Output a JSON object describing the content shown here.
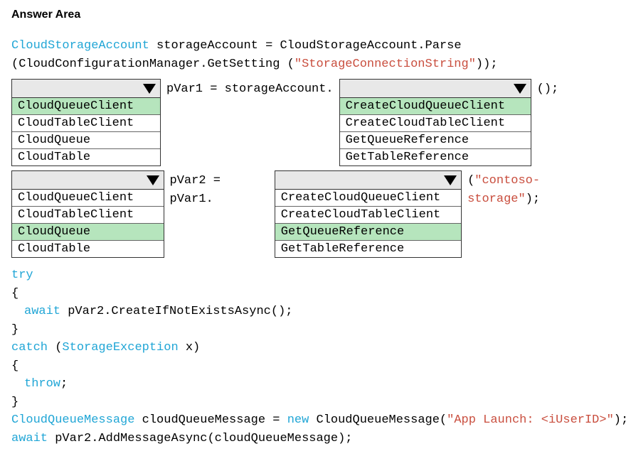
{
  "title": "Answer Area",
  "line1": {
    "type": "CloudStorageAccount",
    "assign": " storageAccount = CloudStorageAccount.Parse"
  },
  "line2": {
    "p1": "(CloudConfigurationManager.GetSetting (",
    "str": "\"StorageConnectionString\"",
    "p2": "));"
  },
  "row1": {
    "mid": " pVar1 = storageAccount.",
    "after": " ();",
    "left": {
      "o0": "CloudQueueClient",
      "o1": "CloudTableClient",
      "o2": "CloudQueue",
      "o3": "CloudTable"
    },
    "right": {
      "o0": "CreateCloudQueueClient",
      "o1": "CreateCloudTableClient",
      "o2": "GetQueueReference",
      "o3": "GetTableReference"
    }
  },
  "row2": {
    "mid": " pVar2 = pVar1.",
    "afterP1": " (",
    "afterStr": "\"contoso-storage\"",
    "afterP2": ");",
    "left": {
      "o0": "CloudQueueClient",
      "o1": "CloudTableClient",
      "o2": "CloudQueue",
      "o3": "CloudTable"
    },
    "right": {
      "o0": "CreateCloudQueueClient",
      "o1": "CreateCloudTableClient",
      "o2": "GetQueueReference",
      "o3": "GetTableReference"
    }
  },
  "tail": {
    "try": "try",
    "brO": "{",
    "await1p1": "await",
    "await1p2": " pVar2.CreateIfNotExistsAsync();",
    "brC": "}",
    "catch1": "catch",
    "catch2": " (",
    "catchEx": "StorageException",
    "catch3": " x)",
    "throw": "throw",
    "semi": ";",
    "cqmType": "CloudQueueMessage",
    "cqm2": " cloudQueueMessage = ",
    "newkw": "new",
    "cqm3": " CloudQueueMessage(",
    "cqmStr": "\"App Launch: <iUserID>\"",
    "cqm4": ");",
    "await2p1": "await",
    "await2p2": " pVar2.AddMessageAsync(cloudQueueMessage);"
  }
}
